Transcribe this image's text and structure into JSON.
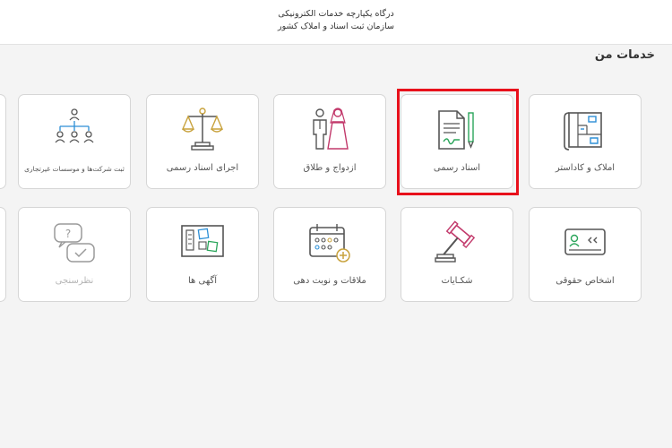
{
  "header": {
    "line1": "درگاه یکپارچه خدمات الکترونیکی",
    "line2": "سازمان ثبت اسناد و املاک کشور"
  },
  "section_title": "خدمات من",
  "colors": {
    "accent_red": "#e8101b",
    "icon_gray": "#555555",
    "icon_green": "#2aa55a",
    "icon_blue": "#2d8fd6",
    "icon_pink": "#c2396b",
    "icon_gold": "#c8a23c"
  },
  "cards": {
    "amlak": {
      "label": "املاک و کاداستر",
      "icon": "cadastre-map-icon"
    },
    "asnad": {
      "label": "اسناد رسمی",
      "icon": "official-document-icon"
    },
    "ezdevaj": {
      "label": "ازدواج و طلاق",
      "icon": "marriage-couple-icon"
    },
    "ejra": {
      "label": "اجرای اسناد رسمی",
      "icon": "justice-scale-icon"
    },
    "sherkat": {
      "label": "ثبت شرکت‌ها و موسسات غیرتجاری",
      "icon": "org-chart-icon"
    },
    "ashkhas": {
      "label": "اشخاص حقوقی",
      "icon": "id-card-icon"
    },
    "shekayat": {
      "label": "شکـایات",
      "icon": "gavel-icon"
    },
    "molaghat": {
      "label": "ملاقات و نوبت دهی",
      "icon": "calendar-add-icon"
    },
    "agahi": {
      "label": "آگهی ها",
      "icon": "notice-board-icon"
    },
    "nazar": {
      "label": "نظرسنجی",
      "icon": "survey-chat-icon"
    }
  }
}
